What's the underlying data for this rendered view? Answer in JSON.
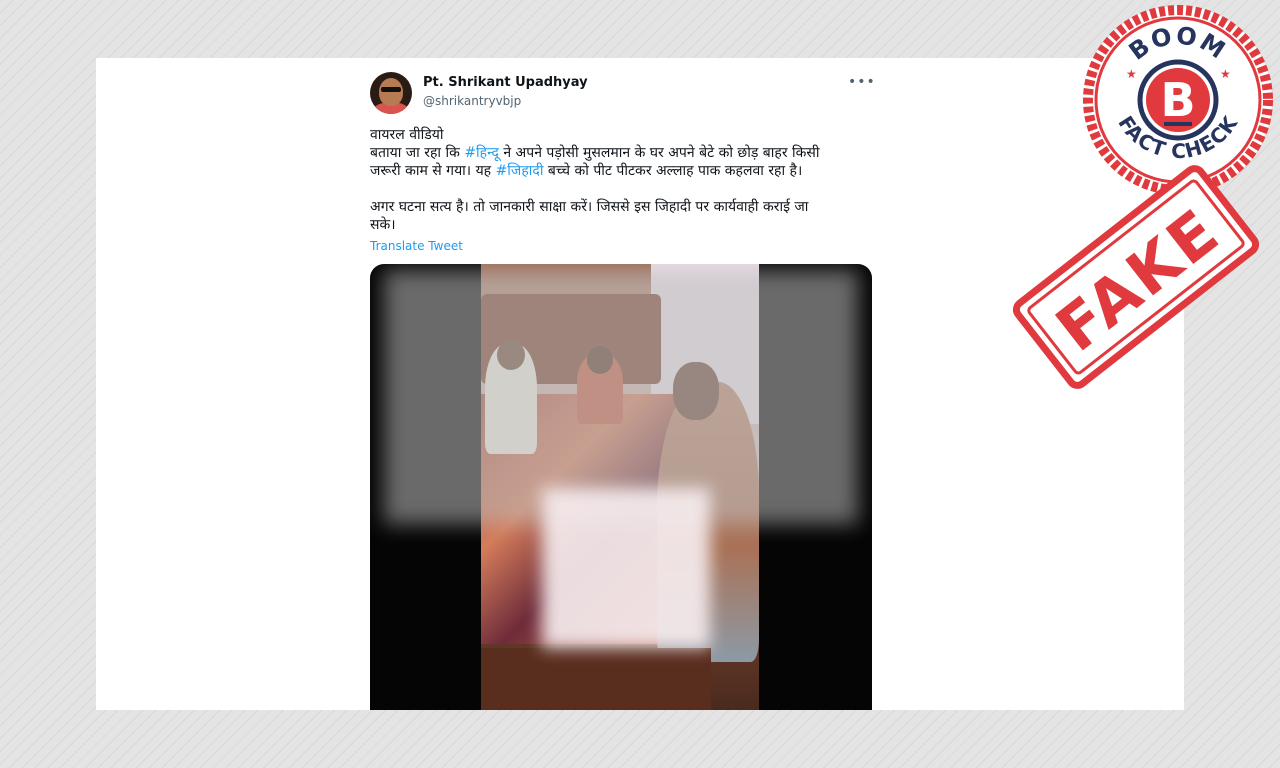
{
  "tweet": {
    "author_name": "Pt. Shrikant Upadhyay",
    "author_handle": "@shrikantryvbjp",
    "more_icon": "more-horizontal-icon",
    "text": {
      "line1": "वायरल वीडियो",
      "line2_a": "बताया जा रहा कि ",
      "hashtag1": "#हिन्दू",
      "line2_b": " ने अपने पड़ोसी मुसलमान के घर अपने बेटे को छोड़ बाहर किसी",
      "line3_a": "जरूरी काम से गया। यह ",
      "hashtag2": "#जिहादी",
      "line3_b": " बच्चे को पीट पीटकर अल्लाह पाक कहलवा रहा है।",
      "line4": "अगर घटना सत्य है। तो जानकारी साक्षा करें। जिससे इस जिहादी पर कार्यवाही कराई जा",
      "line5": "सके।"
    },
    "translate_label": "Translate Tweet"
  },
  "stamp": {
    "brand": "BOOM",
    "subtitle": "FACT CHECK",
    "letter": "B",
    "verdict": "FAKE",
    "color": "#e0393e"
  },
  "colors": {
    "link": "#1d9bf0",
    "text": "#0f1419",
    "muted": "#536471"
  }
}
